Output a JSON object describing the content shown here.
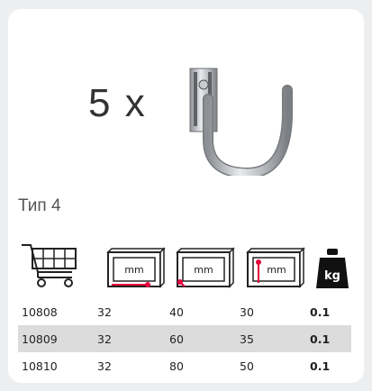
{
  "product": {
    "quantity": "5 x",
    "type_label": "Тип 4"
  },
  "icons": {
    "cart": "shopping-cart-icon",
    "width": "box-width-icon",
    "depth": "box-depth-icon",
    "height": "box-height-icon",
    "weight": "weight-kg-icon",
    "unit_text": "mm",
    "weight_text": "kg",
    "accent_color": "#e5003c"
  },
  "table": {
    "rows": [
      [
        "10808",
        "32",
        "40",
        "30",
        "0.1"
      ],
      [
        "10809",
        "32",
        "60",
        "35",
        "0.1"
      ],
      [
        "10810",
        "32",
        "80",
        "50",
        "0.1"
      ]
    ]
  }
}
